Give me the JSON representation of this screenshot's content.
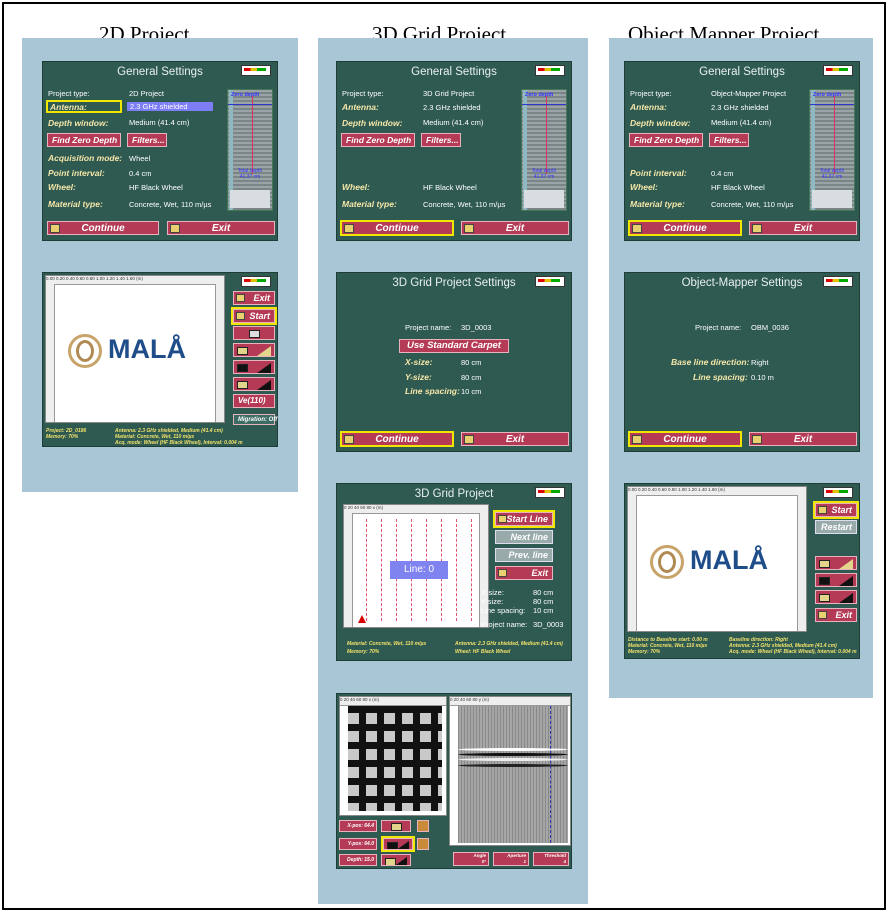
{
  "columns": {
    "c2d": "2D Project",
    "c3d": "3D Grid Project",
    "com": "Object Mapper Project"
  },
  "general": {
    "title": "General Settings",
    "project_type_label": "Project type:",
    "antenna_label": "Antenna:",
    "depth_window_label": "Depth window:",
    "acq_mode_label": "Acquisition mode:",
    "point_interval_label": "Point interval:",
    "wheel_label": "Wheel:",
    "material_label": "Material type:",
    "find_zero": "Find Zero Depth",
    "filters": "Filters...",
    "continue": "Continue",
    "exit": "Exit",
    "antenna_value": "2.3 GHz shielded",
    "depth_value": "Medium (41.4 cm)",
    "acq_value": "Wheel",
    "point_value": "0.4 cm",
    "wheel_value": "HF Black Wheel",
    "material_value": "Concrete, Wet, 110 m/µs",
    "scope_zero": "Zero depth",
    "scope_total": "Total depth",
    "scope_total_val": "41.37 cm",
    "pt_2d": "2D Project",
    "pt_3d": "3D Grid Project",
    "pt_om": "Object-Mapper Project"
  },
  "p2d_screen": {
    "ruler": "0.00  0.20  0.40  0.60  0.80  1.00  1.20  1.40  1.60  (m)",
    "exit": "Exit",
    "start": "Start",
    "vel": "Ve(110)",
    "migration": "Migration: Off",
    "logo": "MALÅ",
    "status1": "Project:   2D_0186",
    "status2": "Memory:   70%",
    "status3": "Antenna:     2.3 GHz shielded, Medium (41.4 cm)",
    "status4": "Material:    Concrete, Wet, 110 m/µs",
    "status5": "Acq. mode: Wheel (HF Black Wheel), Interval: 0.004 m"
  },
  "grid_settings": {
    "title": "3D Grid Project Settings",
    "name_label": "Project name:",
    "name_value": "3D_0003",
    "carpet": "Use Standard Carpet",
    "xsize_label": "X-size:",
    "xsize_value": "80 cm",
    "ysize_label": "Y-size:",
    "ysize_value": "80 cm",
    "spacing_label": "Line spacing:",
    "spacing_value": "10 cm"
  },
  "grid_acq": {
    "title": "3D Grid Project",
    "start_line": "Start Line",
    "next_line": "Next line",
    "prev_line": "Prev. line",
    "exit": "Exit",
    "line_label": "Line: 0",
    "ruler": "0        20        40        60        80  x (m)",
    "x_label": "X-size:",
    "x_value": "80 cm",
    "y_label": "Y-size:",
    "y_value": "80 cm",
    "spacing_label": "Line spacing:",
    "spacing_value": "10 cm",
    "name_label": "Project name:",
    "name_value": "3D_0003",
    "status1": "Material: Concrete, Wet, 110 m/µs",
    "status2": "Memory:   70%",
    "status3": "Antenna: 2.3 GHz shielded, Medium (41.4 cm)",
    "status4": "Wheel: HF Black Wheel"
  },
  "grid_view": {
    "ruler_left": "0     20     40     60     80  x (m)",
    "ruler_right": "0     20     40     60     80  y (m)",
    "xpos": "X-pos: 64.4",
    "ypos": "Y-pos: 64.0",
    "depth": "Depth: 15.0",
    "angle": "Angle",
    "angle_val": "0°",
    "aperture": "Aperture",
    "aperture_val": "1",
    "threshold": "Threshold",
    "threshold_val": "4"
  },
  "om_settings": {
    "title": "Object-Mapper Settings",
    "name_label": "Project name:",
    "name_value": "OBM_0036",
    "baseline_label": "Base line direction:",
    "baseline_value": "Right",
    "spacing_label": "Line spacing:",
    "spacing_value": "0.10 m"
  },
  "om_screen": {
    "ruler": "0.00  0.20  0.40  0.60  0.80  1.00  1.20  1.40  1.60  (m)",
    "start": "Start",
    "restart": "Restart",
    "exit": "Exit",
    "logo": "MALÅ",
    "status1": "Distance to Baseline start: 0.00 m",
    "status2": "Material:    Concrete, Wet, 110 m/µs",
    "status3": "Memory:    70%",
    "status4": "Baseline direction: Right",
    "status5": "Antenna:   2.3 GHz shielded, Medium (41.4 cm)",
    "status6": "Acq. mode: Wheel (HF Black Wheel), Interval: 0.004 m"
  }
}
